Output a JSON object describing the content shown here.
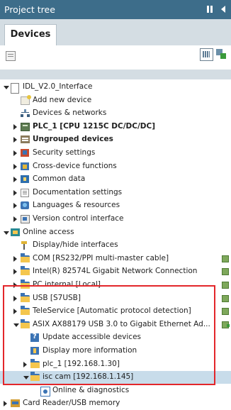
{
  "window": {
    "title": "Project tree"
  },
  "tabs": [
    {
      "label": "Devices",
      "active": true
    }
  ],
  "tree": [
    {
      "label": "IDL_V2.0_Interface",
      "expander": "down",
      "icon": "project-file-icon",
      "indent": 1
    },
    {
      "label": "Add new device",
      "expander": "none",
      "icon": "add-device-icon",
      "indent": 2
    },
    {
      "label": "Devices & networks",
      "expander": "none",
      "icon": "network-icon",
      "indent": 2
    },
    {
      "label": "PLC_1 [CPU 1215C DC/DC/DC]",
      "expander": "right",
      "icon": "plc-icon",
      "indent": 2,
      "bold": true
    },
    {
      "label": "Ungrouped devices",
      "expander": "right",
      "icon": "ungrouped-devices-icon",
      "indent": 2,
      "bold": true
    },
    {
      "label": "Security settings",
      "expander": "right",
      "icon": "security-icon",
      "indent": 2
    },
    {
      "label": "Cross-device functions",
      "expander": "right",
      "icon": "cross-device-icon",
      "indent": 2
    },
    {
      "label": "Common data",
      "expander": "right",
      "icon": "common-data-icon",
      "indent": 2
    },
    {
      "label": "Documentation settings",
      "expander": "right",
      "icon": "documentation-icon",
      "indent": 2
    },
    {
      "label": "Languages & resources",
      "expander": "right",
      "icon": "languages-icon",
      "indent": 2
    },
    {
      "label": "Version control interface",
      "expander": "right",
      "icon": "version-control-icon",
      "indent": 2
    },
    {
      "label": "Online access",
      "expander": "down",
      "icon": "online-access-icon",
      "indent": 1
    },
    {
      "label": "Display/hide interfaces",
      "expander": "none",
      "icon": "plug-icon",
      "indent": 2
    },
    {
      "label": "COM [RS232/PPI multi-master cable]",
      "expander": "right",
      "icon": "folder-icon",
      "indent": 2,
      "status": true
    },
    {
      "label": "Intel(R) 82574L Gigabit Network Connection",
      "expander": "right",
      "icon": "folder-icon",
      "indent": 2,
      "status": true
    },
    {
      "label": "PC internal [Local]",
      "expander": "right",
      "icon": "folder-icon",
      "indent": 2,
      "status": true
    },
    {
      "label": "USB [S7USB]",
      "expander": "right",
      "icon": "folder-icon",
      "indent": 2,
      "status": true
    },
    {
      "label": "TeleService [Automatic protocol detection]",
      "expander": "right",
      "icon": "folder-icon",
      "indent": 2,
      "status": true
    },
    {
      "label": "ASIX AX88179 USB 3.0 to Gigabit Ethernet Ad...",
      "expander": "down",
      "icon": "folder-icon",
      "indent": 2,
      "status": true,
      "status_arrow": true
    },
    {
      "label": "Update accessible devices",
      "expander": "none",
      "icon": "update-devices-icon",
      "indent": 3
    },
    {
      "label": "Display more information",
      "expander": "none",
      "icon": "info-icon",
      "indent": 3
    },
    {
      "label": "plc_1 [192.168.1.30]",
      "expander": "right",
      "icon": "folder-icon",
      "indent": 3
    },
    {
      "label": "isc cam [192.168.1.145]",
      "expander": "down",
      "icon": "folder-icon",
      "indent": 3,
      "selected": true
    },
    {
      "label": "Online & diagnostics",
      "expander": "none",
      "icon": "diagnostics-icon",
      "indent": 4
    },
    {
      "label": "Card Reader/USB memory",
      "expander": "right",
      "icon": "card-reader-icon",
      "indent": 1
    }
  ]
}
